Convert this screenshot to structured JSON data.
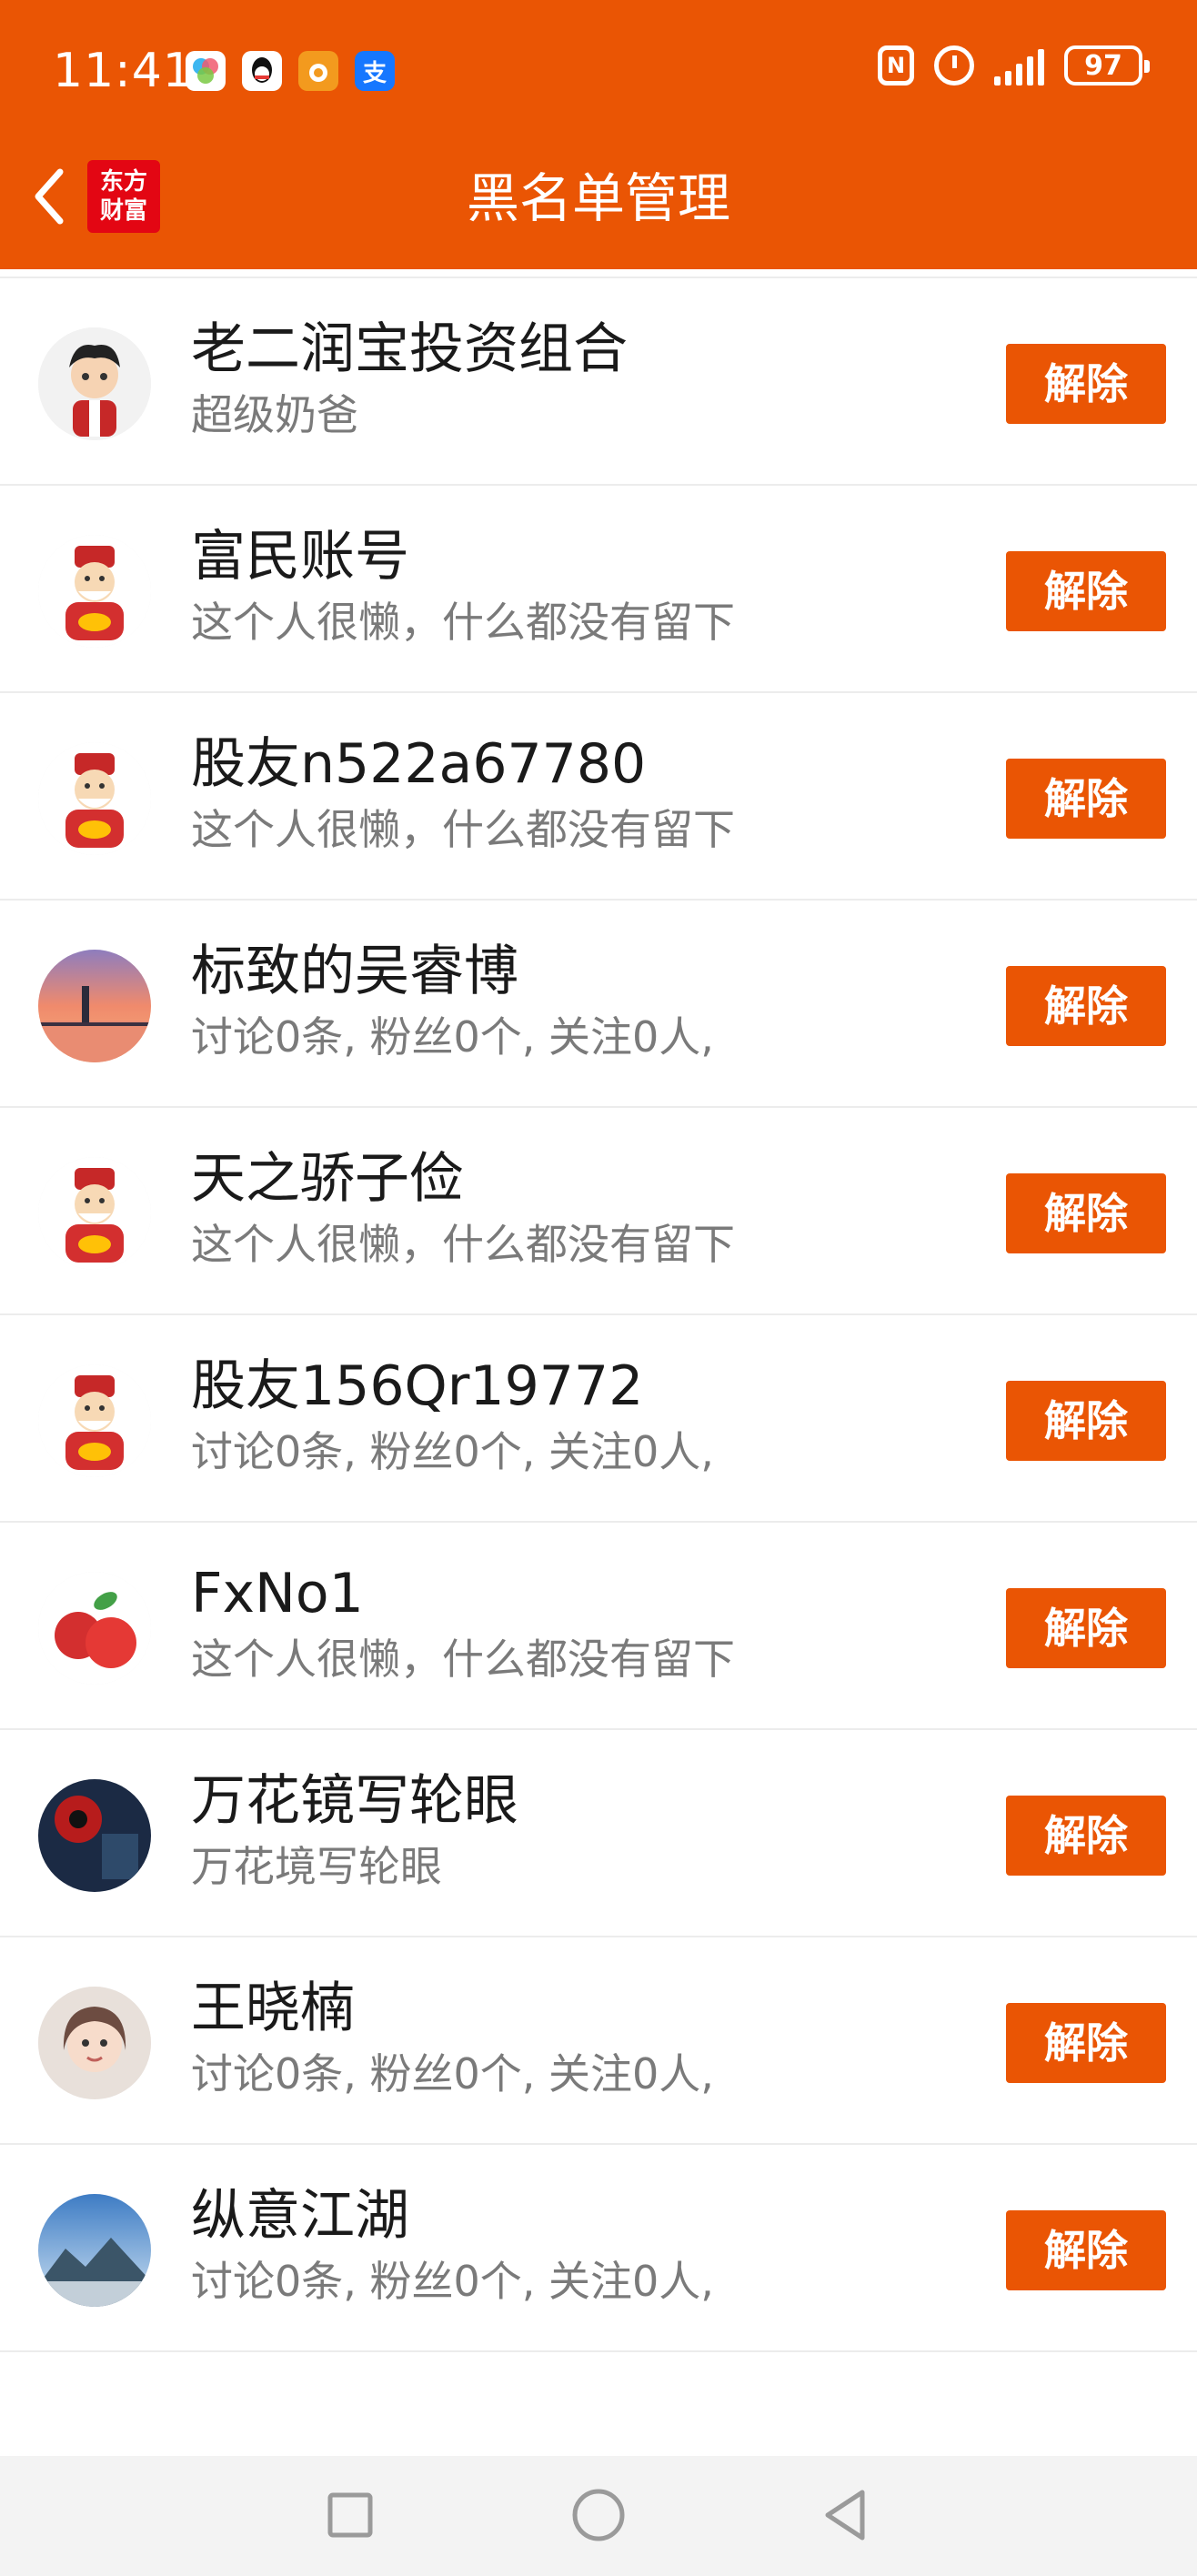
{
  "status_bar": {
    "time": "11:41",
    "battery": "97",
    "app_icons": [
      "photo-app-icon",
      "qq-icon",
      "weibo-like-icon",
      "alipay-icon"
    ],
    "app_icon_labels": [
      "",
      "",
      "",
      "支"
    ]
  },
  "header": {
    "title": "黑名单管理",
    "logo_line1": "东方",
    "logo_line2": "财富",
    "accent_color": "#EA5504"
  },
  "list": {
    "unblock_label": "解除",
    "items": [
      {
        "name": "",
        "desc": "这个人很懒，什么都没有留下",
        "avatar": "caishen"
      },
      {
        "name": "老二润宝投资组合",
        "desc": "超级奶爸",
        "avatar": "boy"
      },
      {
        "name": "富民账号",
        "desc": "这个人很懒，什么都没有留下",
        "avatar": "caishen"
      },
      {
        "name": "股友n522a67780",
        "desc": "这个人很懒，什么都没有留下",
        "avatar": "caishen"
      },
      {
        "name": "标致的吴睿博",
        "desc": "讨论0条, 粉丝0个, 关注0人,",
        "avatar": "sunset"
      },
      {
        "name": "天之骄子俭",
        "desc": "这个人很懒，什么都没有留下",
        "avatar": "caishen"
      },
      {
        "name": "股友156Qr19772",
        "desc": "讨论0条, 粉丝0个, 关注0人,",
        "avatar": "caishen"
      },
      {
        "name": "FxNo1",
        "desc": "这个人很懒，什么都没有留下",
        "avatar": "apple"
      },
      {
        "name": "万花镜写轮眼",
        "desc": "万花境写轮眼",
        "avatar": "sharingan"
      },
      {
        "name": "王晓楠",
        "desc": "讨论0条, 粉丝0个, 关注0人,",
        "avatar": "girl"
      },
      {
        "name": "纵意江湖",
        "desc": "讨论0条, 粉丝0个, 关注0人,",
        "avatar": "mountain"
      }
    ]
  }
}
